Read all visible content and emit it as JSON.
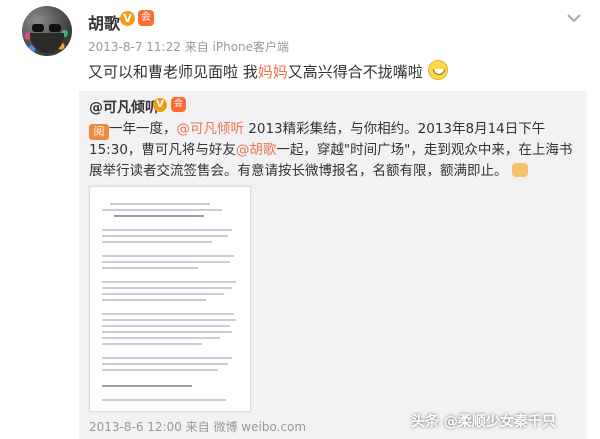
{
  "post": {
    "author": "胡歌",
    "verified_badge": "V",
    "member_badge": "会",
    "time": "2013-8-7 11:22",
    "source": "来自 iPhone客户端",
    "text_part1": "又可以和曹老师见面啦 我",
    "text_link": "妈妈",
    "text_part2": "又高兴得合不拢嘴啦",
    "emoji": "grin-emoji"
  },
  "repost": {
    "author": "@可凡倾听",
    "verified_badge": "V",
    "member_badge": "会",
    "tag": "阅",
    "text_a": "一年一度，",
    "mention1": "@可凡倾听",
    "text_b": " 2013精彩集结，与你相约。2013年8月14日下午15:30，曹可凡将与好友",
    "mention2": "@胡歌",
    "text_c": "一起，穿越\"时间广场\"，走到观众中来，在上海书展举行读者交流签售会。有意请按长微博报名，名额有限，额满即止。",
    "thumb": "thumbs-up-emoji",
    "footer": "2013-8-6 12:00 来自 微博 weibo.com"
  },
  "watermark": "头条 @柔顺少女秦千只",
  "colors": {
    "link": "#eb7350",
    "repost_bg": "#f2f2f5",
    "meta": "#999999"
  }
}
